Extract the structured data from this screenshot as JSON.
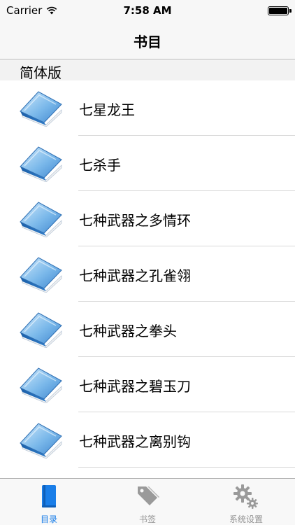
{
  "status_bar": {
    "carrier": "Carrier",
    "time": "7:58 AM"
  },
  "nav": {
    "title": "书目"
  },
  "section": {
    "title": "简体版"
  },
  "books": [
    {
      "title": "七星龙王"
    },
    {
      "title": "七杀手"
    },
    {
      "title": "七种武器之多情环"
    },
    {
      "title": "七种武器之孔雀翎"
    },
    {
      "title": "七种武器之拳头"
    },
    {
      "title": "七种武器之碧玉刀"
    },
    {
      "title": "七种武器之离别钩"
    },
    {
      "title": ""
    }
  ],
  "tabs": [
    {
      "label": "目录",
      "icon": "book-icon",
      "active": true
    },
    {
      "label": "书签",
      "icon": "tag-icon",
      "active": false
    },
    {
      "label": "系统设置",
      "icon": "gear-icon",
      "active": false
    }
  ],
  "colors": {
    "accent": "#1a7ee8",
    "inactive": "#929292"
  }
}
